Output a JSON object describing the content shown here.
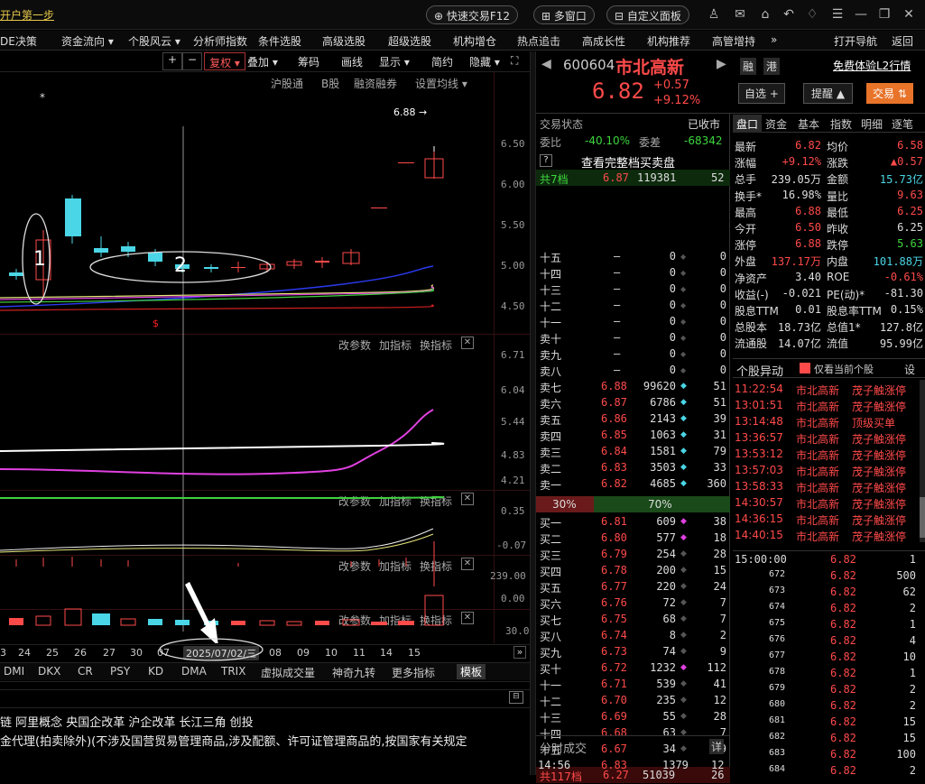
{
  "topbar": {
    "title": "开户第一步",
    "quick_trade": "快速交易F12",
    "multi_window": "多窗口",
    "custom_panel": "自定义面板"
  },
  "menu": [
    "DE决策",
    "资金流向 ▾",
    "个股风云 ▾",
    "分析师指数",
    "条件选股",
    "高级选股",
    "超级选股",
    "机构增仓",
    "热点追击",
    "高成长性",
    "机构推荐",
    "高管增持",
    "»",
    "打开导航",
    "返回"
  ],
  "toolbar": {
    "plus": "+",
    "minus": "−",
    "restore": "复权 ▾",
    "overlay": "叠加 ▾",
    "chips": "筹码",
    "draw": "画线",
    "display": "显示 ▾",
    "simple": "简约",
    "hide": "隐藏 ▾"
  },
  "chart_tabs": [
    "沪股通",
    "B股",
    "融资融券",
    "设置均线 ▾"
  ],
  "price_axis": [
    "6.50",
    "6.00",
    "5.50",
    "5.00",
    "4.50"
  ],
  "price_label": "6.88 →",
  "annotations": {
    "one": "1",
    "two": "2",
    "star": "*",
    "s": "$"
  },
  "vol_axis": [
    "6.71",
    "6.04",
    "5.44",
    "4.83",
    "4.21"
  ],
  "dmi_axis": [
    "0.35",
    "-0.07"
  ],
  "p4_axis": [
    "239.00",
    "0.00"
  ],
  "p5_axis": [
    "30.00"
  ],
  "panel_btns": [
    "改参数",
    "加指标",
    "换指标",
    "✕"
  ],
  "date_axis": [
    "3",
    "24",
    "25",
    "26",
    "27",
    "30",
    "07",
    "08",
    "09",
    "10",
    "11",
    "14",
    "15"
  ],
  "cursor_date": "2025/07/02/三",
  "indicator_tabs": [
    "DMI",
    "DKX",
    "CR",
    "PSY",
    "KD",
    "DMA",
    "TRIX",
    "虚拟成交量",
    "神奇九转",
    "更多指标",
    "模板"
  ],
  "info": {
    "line1": "链  阿里概念  央国企改革  沪企改革  长江三角  创投",
    "line2": "金代理(拍卖除外)(不涉及国营贸易管理商品,涉及配额、许可证管理商品的,按国家有关规定"
  },
  "stock": {
    "code": "600604",
    "name": "市北高新",
    "price": "6.82",
    "change": "+0.57",
    "pct": "+9.12%",
    "hk": "融",
    "hk2": "港",
    "free_l2": "免费体验L2行情",
    "self": "自选 +",
    "alert": "提醒 ▲",
    "trade": "交易 ⇅"
  },
  "status": {
    "label": "交易状态",
    "value": "已收市",
    "wb_label": "委比",
    "wb": "-40.10%",
    "wc_label": "委差",
    "wc": "-68342",
    "full_btn": "查看完整档买卖盘",
    "total7": "共7档",
    "total7_price": "6.87",
    "total7_vol": "119381",
    "total7_n": "52"
  },
  "asks": [
    [
      "十五",
      "—",
      "0",
      "0"
    ],
    [
      "十四",
      "—",
      "0",
      "0"
    ],
    [
      "十三",
      "—",
      "0",
      "0"
    ],
    [
      "十二",
      "—",
      "0",
      "0"
    ],
    [
      "十一",
      "—",
      "0",
      "0"
    ],
    [
      "卖十",
      "—",
      "0",
      "0"
    ],
    [
      "卖九",
      "—",
      "0",
      "0"
    ],
    [
      "卖八",
      "—",
      "0",
      "0"
    ],
    [
      "卖七",
      "6.88",
      "99620",
      "51"
    ],
    [
      "卖六",
      "6.87",
      "6786",
      "51"
    ],
    [
      "卖五",
      "6.86",
      "2143",
      "39"
    ],
    [
      "卖四",
      "6.85",
      "1063",
      "31"
    ],
    [
      "卖三",
      "6.84",
      "1581",
      "79"
    ],
    [
      "卖二",
      "6.83",
      "3503",
      "33"
    ],
    [
      "卖一",
      "6.82",
      "4685",
      "360"
    ]
  ],
  "ratio": {
    "left": "30%",
    "right": "70%"
  },
  "bids": [
    [
      "买一",
      "6.81",
      "609",
      "38"
    ],
    [
      "买二",
      "6.80",
      "577",
      "18"
    ],
    [
      "买三",
      "6.79",
      "254",
      "28"
    ],
    [
      "买四",
      "6.78",
      "200",
      "15"
    ],
    [
      "买五",
      "6.77",
      "220",
      "24"
    ],
    [
      "买六",
      "6.76",
      "72",
      "7"
    ],
    [
      "买七",
      "6.75",
      "68",
      "7"
    ],
    [
      "买八",
      "6.74",
      "8",
      "2"
    ],
    [
      "买九",
      "6.73",
      "74",
      "9"
    ],
    [
      "买十",
      "6.72",
      "1232",
      "112"
    ],
    [
      "十一",
      "6.71",
      "539",
      "41"
    ],
    [
      "十二",
      "6.70",
      "235",
      "12"
    ],
    [
      "十三",
      "6.69",
      "55",
      "28"
    ],
    [
      "十四",
      "6.68",
      "63",
      "7"
    ],
    [
      "十五",
      "6.67",
      "34",
      "9"
    ]
  ],
  "total117": {
    "label": "共117档",
    "price": "6.27",
    "vol": "51039",
    "n": "26"
  },
  "timeshare": {
    "label": "分时成交",
    "detail": "详",
    "time": "14:56",
    "price": "6.83",
    "vol": "1379",
    "n": "12"
  },
  "qtabs": [
    "盘口",
    "资金",
    "基本",
    "指数",
    "明细",
    "逐笔"
  ],
  "quote": [
    [
      "最新",
      "6.82",
      "均价",
      "6.58"
    ],
    [
      "涨幅",
      "+9.12%",
      "涨跌",
      "▲0.57"
    ],
    [
      "总手",
      "239.05万",
      "金额",
      "15.73亿"
    ],
    [
      "换手*",
      "16.98%",
      "量比",
      "9.63"
    ],
    [
      "最高",
      "6.88",
      "最低",
      "6.25"
    ],
    [
      "今开",
      "6.50",
      "昨收",
      "6.25"
    ],
    [
      "涨停",
      "6.88",
      "跌停",
      "5.63"
    ],
    [
      "外盘",
      "137.17万",
      "内盘",
      "101.88万"
    ],
    [
      "净资产",
      "3.40",
      "ROE",
      "-0.61%"
    ],
    [
      "收益(-)",
      "-0.021",
      "PE(动)*",
      "-81.30"
    ],
    [
      "股息TTM",
      "0.01",
      "股息率TTM",
      "0.15%"
    ],
    [
      "总股本",
      "18.73亿",
      "总值1*",
      "127.8亿"
    ],
    [
      "流通股",
      "14.07亿",
      "流值",
      "95.99亿"
    ]
  ],
  "alerts_hdr": {
    "title": "个股异动",
    "only": "仅看当前个股",
    "set": "设"
  },
  "alerts": [
    [
      "11:22:54",
      "市北高新",
      "茂子触涨停"
    ],
    [
      "13:01:51",
      "市北高新",
      "茂子触涨停"
    ],
    [
      "13:14:48",
      "市北高新",
      "顶级买单"
    ],
    [
      "13:36:57",
      "市北高新",
      "茂子触涨停"
    ],
    [
      "13:53:12",
      "市北高新",
      "茂子触涨停"
    ],
    [
      "13:57:03",
      "市北高新",
      "茂子触涨停"
    ],
    [
      "13:58:33",
      "市北高新",
      "茂子触涨停"
    ],
    [
      "14:30:57",
      "市北高新",
      "茂子触涨停"
    ],
    [
      "14:36:15",
      "市北高新",
      "茂子触涨停"
    ],
    [
      "14:40:15",
      "市北高新",
      "茂子触涨停"
    ]
  ],
  "ticks_first": [
    "15:00:00",
    "6.82",
    "1"
  ],
  "ticks": [
    [
      "672",
      "6.82",
      "500"
    ],
    [
      "673",
      "6.82",
      "62"
    ],
    [
      "674",
      "6.82",
      "2"
    ],
    [
      "675",
      "6.82",
      "1"
    ],
    [
      "676",
      "6.82",
      "4"
    ],
    [
      "677",
      "6.82",
      "10"
    ],
    [
      "678",
      "6.82",
      "1"
    ],
    [
      "679",
      "6.82",
      "2"
    ],
    [
      "680",
      "6.82",
      "2"
    ],
    [
      "681",
      "6.82",
      "15"
    ],
    [
      "682",
      "6.82",
      "15"
    ],
    [
      "683",
      "6.82",
      "100"
    ],
    [
      "684",
      "6.82",
      "2"
    ]
  ],
  "colors": {
    "up": "#ff4a4a",
    "down": "#3dd63d",
    "cyan": "#4ad6e6",
    "yellow": "#e6c84a"
  }
}
